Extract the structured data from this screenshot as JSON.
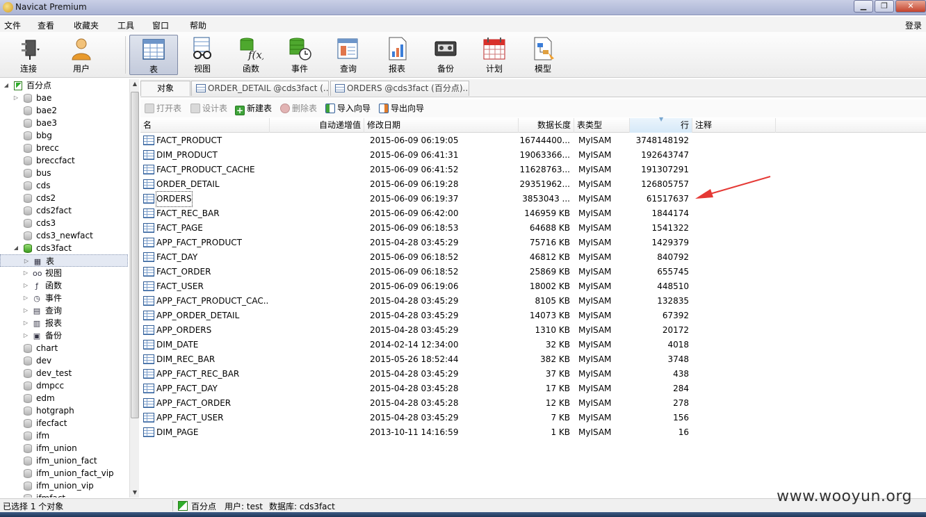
{
  "window": {
    "title": "Navicat Premium",
    "login": "登录"
  },
  "menu": [
    "文件",
    "查看",
    "收藏夹",
    "工具",
    "窗口",
    "帮助"
  ],
  "toolbar": [
    {
      "label": "连接",
      "icon": "plug-icon"
    },
    {
      "label": "用户",
      "icon": "user-icon"
    },
    {
      "label": "表",
      "icon": "table-icon",
      "active": true
    },
    {
      "label": "视图",
      "icon": "glasses-icon"
    },
    {
      "label": "函数",
      "icon": "function-icon"
    },
    {
      "label": "事件",
      "icon": "event-clock-icon"
    },
    {
      "label": "查询",
      "icon": "query-icon"
    },
    {
      "label": "报表",
      "icon": "report-icon"
    },
    {
      "label": "备份",
      "icon": "backup-tape-icon"
    },
    {
      "label": "计划",
      "icon": "calendar-icon"
    },
    {
      "label": "模型",
      "icon": "model-icon"
    }
  ],
  "tree": {
    "connection": "百分点",
    "databases_before": [
      "bae",
      "bae2",
      "bae3",
      "bbg",
      "brecc",
      "breccfact",
      "bus",
      "cds",
      "cds2",
      "cds2fact",
      "cds3",
      "cds3_newfact"
    ],
    "open_db": "cds3fact",
    "open_db_children": [
      {
        "label": "表",
        "icon": "table-icon",
        "selected": true
      },
      {
        "label": "视图",
        "icon": "glasses-icon"
      },
      {
        "label": "函数",
        "icon": "function-icon"
      },
      {
        "label": "事件",
        "icon": "event-clock-icon"
      },
      {
        "label": "查询",
        "icon": "query-icon"
      },
      {
        "label": "报表",
        "icon": "report-icon"
      },
      {
        "label": "备份",
        "icon": "backup-tape-icon"
      }
    ],
    "databases_after": [
      "chart",
      "dev",
      "dev_test",
      "dmpcc",
      "edm",
      "hotgraph",
      "ifecfact",
      "ifm",
      "ifm_union",
      "ifm_union_fact",
      "ifm_union_fact_vip",
      "ifm_union_vip",
      "ifmfact"
    ]
  },
  "tabs": [
    "对象",
    "ORDER_DETAIL @cds3fact (...",
    "ORDERS @cds3fact (百分点)..."
  ],
  "object_toolbar": [
    {
      "label": "打开表",
      "enabled": false
    },
    {
      "label": "设计表",
      "enabled": false
    },
    {
      "label": "新建表",
      "enabled": true
    },
    {
      "label": "删除表",
      "enabled": false
    },
    {
      "label": "导入向导",
      "enabled": true
    },
    {
      "label": "导出向导",
      "enabled": true
    }
  ],
  "columns": [
    "名",
    "自动递增值",
    "修改日期",
    "数据长度",
    "表类型",
    "行",
    "注释"
  ],
  "rows": [
    {
      "name": "FACT_PRODUCT",
      "date": "2015-06-09 06:19:05",
      "size": "16744400...",
      "type": "MyISAM",
      "rows": "3748148192"
    },
    {
      "name": "DIM_PRODUCT",
      "date": "2015-06-09 06:41:31",
      "size": "19063366...",
      "type": "MyISAM",
      "rows": "192643747"
    },
    {
      "name": "FACT_PRODUCT_CACHE",
      "date": "2015-06-09 06:41:52",
      "size": "11628763...",
      "type": "MyISAM",
      "rows": "191307291"
    },
    {
      "name": "ORDER_DETAIL",
      "date": "2015-06-09 06:19:28",
      "size": "29351962...",
      "type": "MyISAM",
      "rows": "126805757"
    },
    {
      "name": "ORDERS",
      "date": "2015-06-09 06:19:37",
      "size": "3853043 ...",
      "type": "MyISAM",
      "rows": "61517637",
      "focused": true
    },
    {
      "name": "FACT_REC_BAR",
      "date": "2015-06-09 06:42:00",
      "size": "146959 KB",
      "type": "MyISAM",
      "rows": "1844174"
    },
    {
      "name": "FACT_PAGE",
      "date": "2015-06-09 06:18:53",
      "size": "64688 KB",
      "type": "MyISAM",
      "rows": "1541322"
    },
    {
      "name": "APP_FACT_PRODUCT",
      "date": "2015-04-28 03:45:29",
      "size": "75716 KB",
      "type": "MyISAM",
      "rows": "1429379"
    },
    {
      "name": "FACT_DAY",
      "date": "2015-06-09 06:18:52",
      "size": "46812 KB",
      "type": "MyISAM",
      "rows": "840792"
    },
    {
      "name": "FACT_ORDER",
      "date": "2015-06-09 06:18:52",
      "size": "25869 KB",
      "type": "MyISAM",
      "rows": "655745"
    },
    {
      "name": "FACT_USER",
      "date": "2015-06-09 06:19:06",
      "size": "18002 KB",
      "type": "MyISAM",
      "rows": "448510"
    },
    {
      "name": "APP_FACT_PRODUCT_CAC...",
      "date": "2015-04-28 03:45:29",
      "size": "8105 KB",
      "type": "MyISAM",
      "rows": "132835"
    },
    {
      "name": "APP_ORDER_DETAIL",
      "date": "2015-04-28 03:45:29",
      "size": "14073 KB",
      "type": "MyISAM",
      "rows": "67392"
    },
    {
      "name": "APP_ORDERS",
      "date": "2015-04-28 03:45:29",
      "size": "1310 KB",
      "type": "MyISAM",
      "rows": "20172"
    },
    {
      "name": "DIM_DATE",
      "date": "2014-02-14 12:34:00",
      "size": "32 KB",
      "type": "MyISAM",
      "rows": "4018"
    },
    {
      "name": "DIM_REC_BAR",
      "date": "2015-05-26 18:52:44",
      "size": "382 KB",
      "type": "MyISAM",
      "rows": "3748"
    },
    {
      "name": "APP_FACT_REC_BAR",
      "date": "2015-04-28 03:45:29",
      "size": "37 KB",
      "type": "MyISAM",
      "rows": "438"
    },
    {
      "name": "APP_FACT_DAY",
      "date": "2015-04-28 03:45:28",
      "size": "17 KB",
      "type": "MyISAM",
      "rows": "284"
    },
    {
      "name": "APP_FACT_ORDER",
      "date": "2015-04-28 03:45:28",
      "size": "12 KB",
      "type": "MyISAM",
      "rows": "278"
    },
    {
      "name": "APP_FACT_USER",
      "date": "2015-04-28 03:45:29",
      "size": "7 KB",
      "type": "MyISAM",
      "rows": "156"
    },
    {
      "name": "DIM_PAGE",
      "date": "2013-10-11 14:16:59",
      "size": "1 KB",
      "type": "MyISAM",
      "rows": "16"
    }
  ],
  "status": {
    "selection": "已选择 1 个对象",
    "connection": "百分点",
    "user": "用户: test",
    "database": "数据库: cds3fact"
  },
  "watermark": "www.wooyun.org",
  "colors": {
    "annotation_arrow": "#e53935",
    "selection": "#e4e9f3",
    "sorted_header": "#d6e9f8"
  }
}
